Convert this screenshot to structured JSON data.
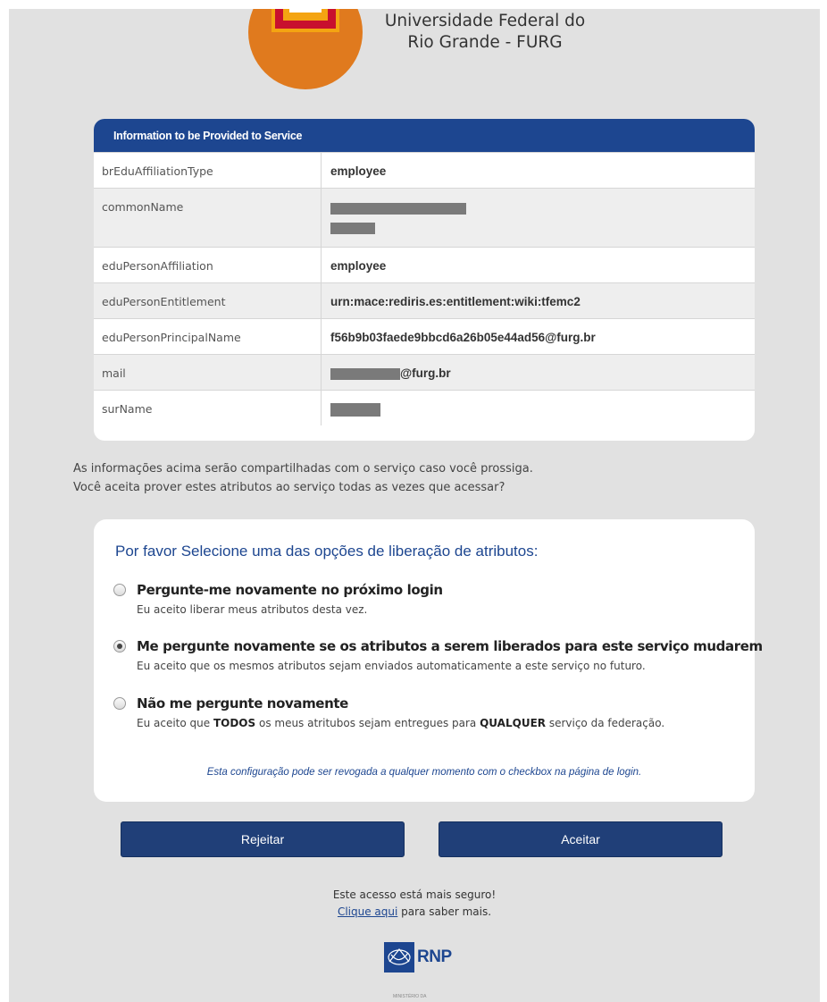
{
  "header": {
    "university_line1": "Universidade Federal do",
    "university_line2": "Rio Grande - FURG"
  },
  "attributes": {
    "title": "Information to be Provided to Service",
    "rows": [
      {
        "name": "brEduAffiliationType",
        "value": "employee"
      },
      {
        "name": "commonName",
        "value": ""
      },
      {
        "name": "eduPersonAffiliation",
        "value": "employee"
      },
      {
        "name": "eduPersonEntitlement",
        "value": "urn:mace:rediris.es:entitlement:wiki:tfemc2"
      },
      {
        "name": "eduPersonPrincipalName",
        "value": "f56b9b03faede9bbcd6a26b05e44ad56@furg.br"
      },
      {
        "name": "mail",
        "value": "@furg.br"
      },
      {
        "name": "surName",
        "value": ""
      }
    ]
  },
  "info": {
    "line1": "As informações acima serão compartilhadas com o serviço caso você prossiga.",
    "line2": "Você aceita prover estes atributos ao serviço todas as vezes que acessar?"
  },
  "options": {
    "title": "Por favor Selecione uma das opções de liberação de atributos:",
    "items": [
      {
        "label": "Pergunte-me novamente no próximo login",
        "desc": "Eu aceito liberar meus atributos desta vez.",
        "checked": false
      },
      {
        "label": "Me pergunte novamente se os atributos a serem liberados para este serviço mudarem",
        "desc": "Eu aceito que os mesmos atributos sejam enviados automaticamente a este serviço no futuro.",
        "checked": true
      },
      {
        "label": "Não me pergunte novamente",
        "desc_before": "Eu aceito que ",
        "desc_bold1": "TODOS",
        "desc_middle": " os meus atritubos sejam entregues para ",
        "desc_bold2": "QUALQUER",
        "desc_after": " serviço da federação.",
        "checked": false
      }
    ],
    "note": "Esta configuração pode ser revogada a qualquer momento com o checkbox na página de login."
  },
  "buttons": {
    "reject": "Rejeitar",
    "accept": "Aceitar"
  },
  "footer": {
    "secure_text": "Este acesso está mais seguro!",
    "link_text": "Clique aqui",
    "link_suffix": " para saber mais.",
    "rnp_logo": "RNP",
    "tiny_text": "MINISTÉRIO DA"
  },
  "colors": {
    "brand_blue": "#1d4690",
    "button_blue": "#203f78",
    "logo_orange": "#e07a1e",
    "logo_red": "#c8102e"
  }
}
